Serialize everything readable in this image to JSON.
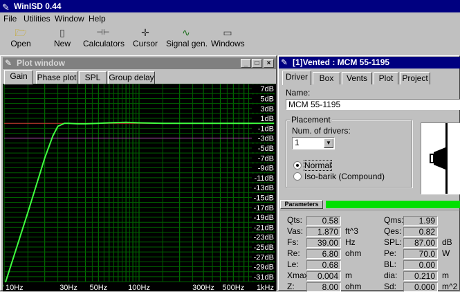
{
  "app": {
    "title": "WinISD 0.44"
  },
  "menu": [
    "File",
    "Utilities",
    "Window",
    "Help"
  ],
  "toolbar": [
    {
      "label": "Open",
      "icon": "folder-open-icon",
      "glyph": "🗁"
    },
    {
      "label": "New",
      "icon": "new-document-icon",
      "glyph": "▯"
    },
    {
      "label": "Calculators",
      "icon": "calculator-icon",
      "glyph": "⊣⊢"
    },
    {
      "label": "Cursor",
      "icon": "cursor-crosshair-icon",
      "glyph": "✛"
    },
    {
      "label": "Signal gen.",
      "icon": "signal-generator-icon",
      "glyph": "∿"
    },
    {
      "label": "Windows",
      "icon": "windows-icon",
      "glyph": "▭"
    }
  ],
  "plot_window": {
    "title": "Plot window",
    "tabs": [
      "Gain",
      "Phase plot",
      "SPL",
      "Group delay"
    ],
    "active_tab": "Gain"
  },
  "chart_data": {
    "type": "line",
    "x_scale": "log",
    "xlim": [
      10,
      1000
    ],
    "ylim": [
      -32,
      8
    ],
    "grid": true,
    "x_tick_labels": [
      {
        "value": 10,
        "label": "10Hz"
      },
      {
        "value": 30,
        "label": "30Hz"
      },
      {
        "value": 50,
        "label": "50Hz"
      },
      {
        "value": 100,
        "label": "100Hz"
      },
      {
        "value": 300,
        "label": "300Hz"
      },
      {
        "value": 500,
        "label": "500Hz"
      },
      {
        "value": 1000,
        "label": "1kHz"
      }
    ],
    "y_tick_labels": [
      {
        "value": 7,
        "label": "7dB"
      },
      {
        "value": 5,
        "label": "5dB"
      },
      {
        "value": 3,
        "label": "3dB"
      },
      {
        "value": 1,
        "label": "1dB"
      },
      {
        "value": -1,
        "label": "-1dB"
      },
      {
        "value": -3,
        "label": "-3dB"
      },
      {
        "value": -5,
        "label": "-5dB"
      },
      {
        "value": -7,
        "label": "-7dB"
      },
      {
        "value": -9,
        "label": "-9dB"
      },
      {
        "value": -11,
        "label": "-11dB"
      },
      {
        "value": -13,
        "label": "-13dB"
      },
      {
        "value": -15,
        "label": "-15dB"
      },
      {
        "value": -17,
        "label": "-17dB"
      },
      {
        "value": -19,
        "label": "-19dB"
      },
      {
        "value": -21,
        "label": "-21dB"
      },
      {
        "value": -23,
        "label": "-23dB"
      },
      {
        "value": -25,
        "label": "-25dB"
      },
      {
        "value": -27,
        "label": "-27dB"
      },
      {
        "value": -29,
        "label": "-29dB"
      },
      {
        "value": -31,
        "label": "-31dB"
      }
    ],
    "reference_lines": [
      {
        "y": 0,
        "color": "#d03030"
      },
      {
        "y": -3,
        "color": "#c040c0"
      }
    ],
    "series": [
      {
        "color": "#40ff40",
        "x": [
          10,
          15,
          20,
          23,
          25,
          28,
          30,
          35,
          40,
          50,
          60,
          80,
          100,
          150,
          200,
          300,
          500,
          700,
          1000
        ],
        "y": [
          -33,
          -18,
          -7,
          -2.5,
          -0.6,
          0.0,
          0.0,
          -0.1,
          -0.1,
          0.0,
          0.1,
          0.2,
          0.1,
          0.0,
          0.0,
          0.0,
          0.0,
          0.0,
          0.0
        ]
      }
    ]
  },
  "driver_window": {
    "title": "[1]Vented : MCM 55-1195",
    "tabs": [
      "Driver",
      "Box",
      "Vents",
      "Plot",
      "Project"
    ],
    "active_tab": "Driver",
    "name_label": "Name:",
    "name_value": "MCM 55-1195",
    "placement": {
      "legend": "Placement",
      "num_drivers_label": "Num. of drivers:",
      "num_drivers_value": "1",
      "options": [
        {
          "label": "Normal",
          "selected": true
        },
        {
          "label": "Iso-barik (Compound)",
          "selected": false
        }
      ]
    },
    "parameters_tab": "Parameters",
    "parameters": [
      {
        "name": "Qts:",
        "value": "0.58",
        "unit": ""
      },
      {
        "name": "Vas:",
        "value": "1.870",
        "unit": "ft^3"
      },
      {
        "name": "Fs:",
        "value": "39.00",
        "unit": "Hz"
      },
      {
        "name": "Re:",
        "value": "6.80",
        "unit": "ohm"
      },
      {
        "name": "Le:",
        "value": "0.68",
        "unit": ""
      },
      {
        "name": "Xmax:",
        "value": "0.004",
        "unit": "m"
      },
      {
        "name": "Z:",
        "value": "8.00",
        "unit": "ohm"
      },
      {
        "name": "Qms:",
        "value": "1.99",
        "unit": ""
      },
      {
        "name": "Qes:",
        "value": "0.82",
        "unit": ""
      },
      {
        "name": "SPL:",
        "value": "87.00",
        "unit": "dB"
      },
      {
        "name": "Pe:",
        "value": "70.0",
        "unit": "W"
      },
      {
        "name": "BL:",
        "value": "0.00",
        "unit": ""
      },
      {
        "name": "dia:",
        "value": "0.210",
        "unit": "m"
      },
      {
        "name": "Sd:",
        "value": "0.000",
        "unit": "m^2"
      }
    ]
  }
}
